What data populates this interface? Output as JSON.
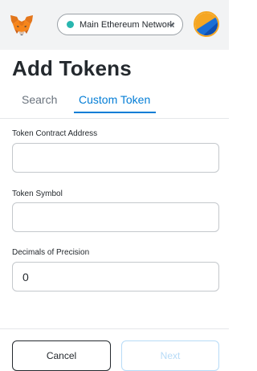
{
  "header": {
    "network": {
      "label": "Main Ethereum Network",
      "status_color": "#29b6af"
    },
    "logo_icon": "metamask-fox-icon",
    "account_icon": "account-avatar-icon"
  },
  "page": {
    "title": "Add Tokens"
  },
  "tabs": [
    {
      "label": "Search",
      "active": false
    },
    {
      "label": "Custom Token",
      "active": true
    }
  ],
  "form": {
    "contract_address": {
      "label": "Token Contract Address",
      "value": ""
    },
    "symbol": {
      "label": "Token Symbol",
      "value": ""
    },
    "decimals": {
      "label": "Decimals of Precision",
      "value": "0"
    }
  },
  "footer": {
    "cancel_label": "Cancel",
    "next_label": "Next",
    "next_enabled": false
  },
  "colors": {
    "accent": "#037dd6",
    "disabled_accent": "#b7dbf7",
    "text": "#24292e"
  }
}
